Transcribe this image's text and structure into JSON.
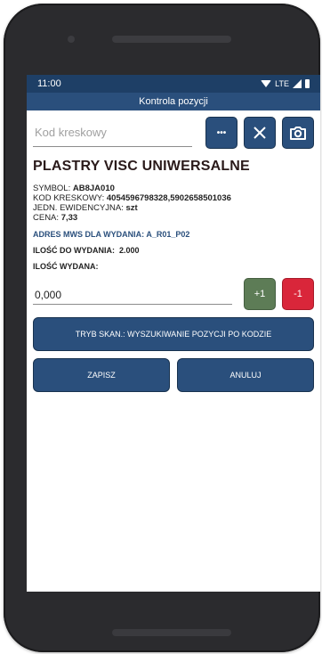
{
  "status_bar": {
    "time": "11:00",
    "network": "LTE"
  },
  "app_bar": {
    "title": "Kontrola pozycji"
  },
  "search": {
    "placeholder": "Kod kreskowy",
    "value": ""
  },
  "product": {
    "name": "PLASTRY VISC UNIWERSALNE",
    "symbol_label": "SYMBOL:",
    "symbol_value": "AB8JA010",
    "barcode_label": "KOD KRESKOWY:",
    "barcode_value": "4054596798328,5902658501036",
    "unit_label": "JEDN. EWIDENCYJNA:",
    "unit_value": "szt",
    "price_label": "CENA:",
    "price_value": "7,33"
  },
  "location": {
    "label": "ADRES MWS DLA WYDANIA:",
    "value": "A_R01_P02"
  },
  "quantity_to_issue": {
    "label": "ILOŚĆ DO WYDANIA:",
    "value": "2.000"
  },
  "quantity_issued": {
    "label": "ILOŚĆ WYDANA:",
    "value": "0,000"
  },
  "buttons": {
    "more": "•••",
    "plus": "+1",
    "minus": "-1",
    "scan_mode": "TRYB SKAN.: WYSZUKIWANIE POZYCJI PO KODZIE",
    "save": "ZAPISZ",
    "cancel": "ANULUJ"
  },
  "colors": {
    "primary": "#2a4f7c",
    "statusbar": "#1e3f66",
    "plus": "#5d7c56",
    "minus": "#d9263a"
  },
  "icons": [
    "more-icon",
    "close-icon",
    "camera-icon",
    "wifi-icon",
    "signal-icon",
    "battery-icon"
  ]
}
